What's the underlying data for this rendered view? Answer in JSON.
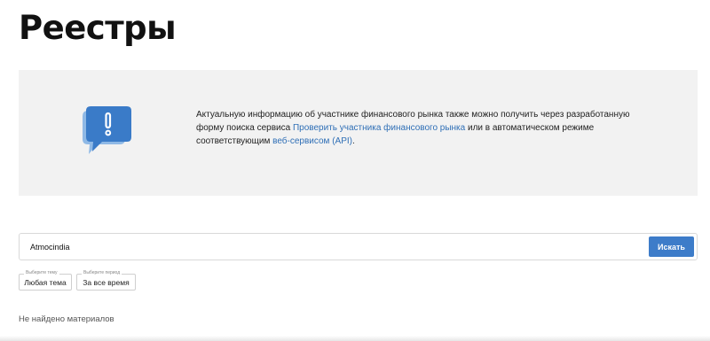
{
  "page": {
    "title": "Реестры"
  },
  "info": {
    "text_before": "Актуальную информацию об участнике финансового рынка также можно получить через разработанную форму поиска сервиса ",
    "link1": "Проверить участника финансового рынка",
    "text_middle": " или в автоматическом режиме соответствующим ",
    "link2": "веб-сервисом (API)",
    "text_after": ".",
    "icon": "chat-bubble-exclamation-icon",
    "icon_colors": {
      "front": "#3a7bc8",
      "back": "#8fb9e6"
    }
  },
  "search": {
    "value": "Atmocindia",
    "button_label": "Искать",
    "accent": "#3d7cc9"
  },
  "filters": {
    "topic": {
      "caption": "Выберите тему",
      "value": "Любая тема"
    },
    "period": {
      "caption": "Выберите период",
      "value": "За все время"
    }
  },
  "results": {
    "empty_message": "Не найдено материалов"
  }
}
